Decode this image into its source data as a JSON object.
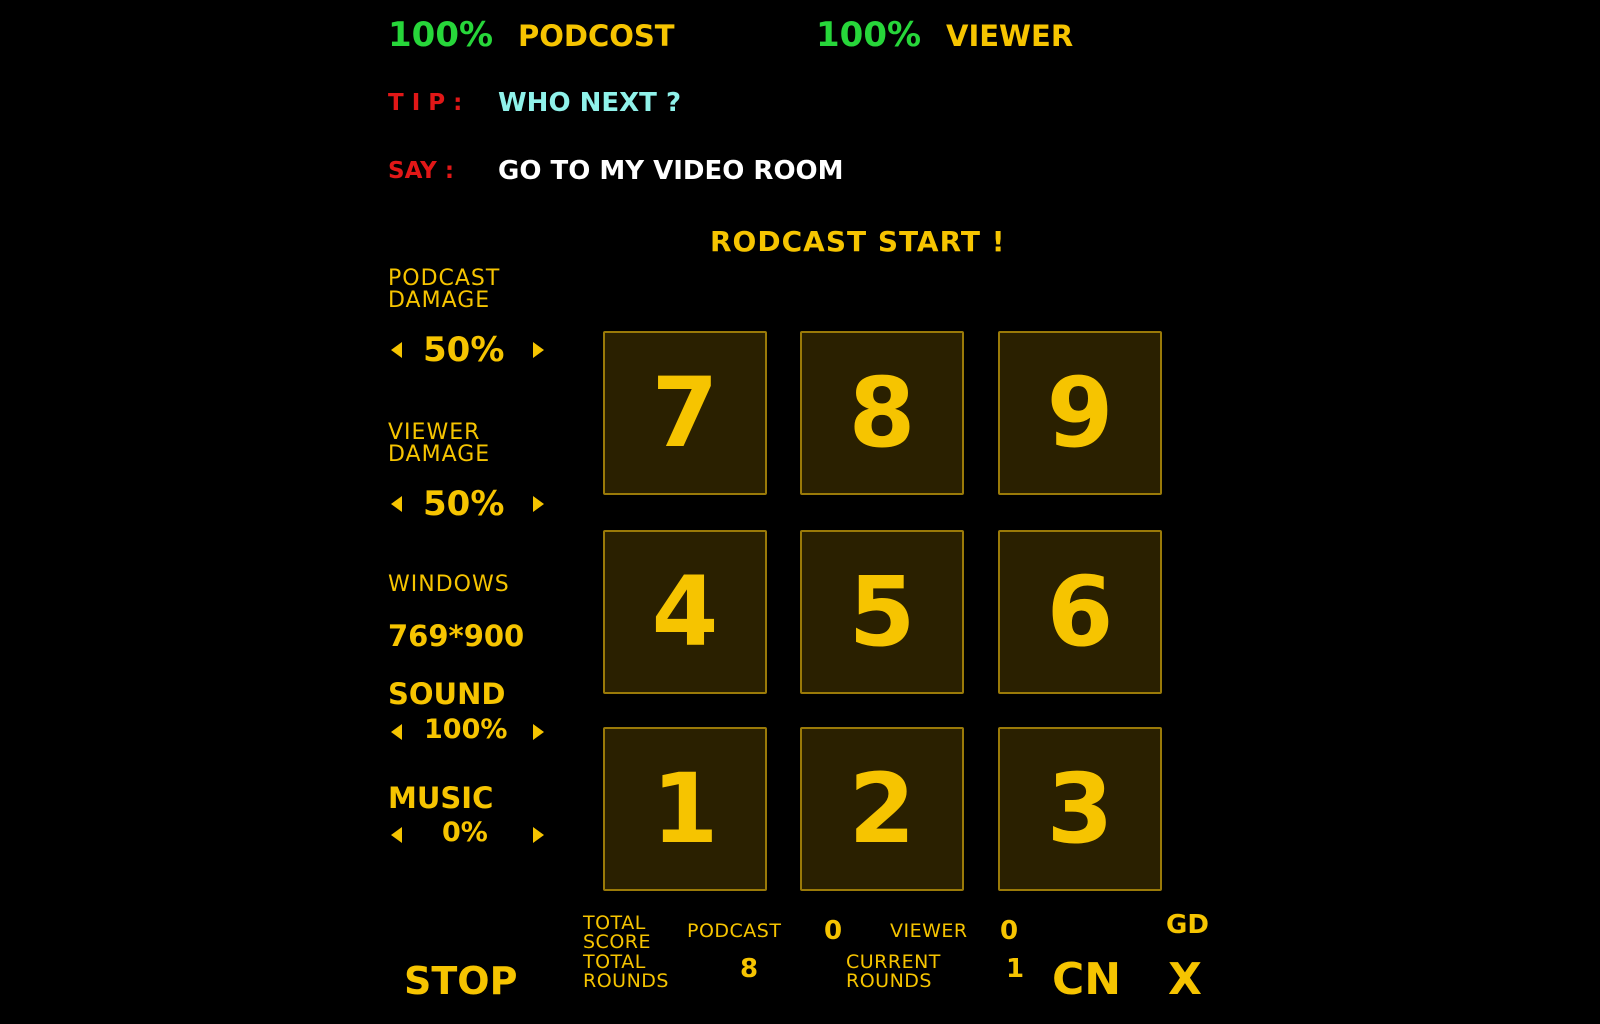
{
  "header": {
    "podcast_health": "100%",
    "podcast_label": "PODCOST",
    "viewer_health": "100%",
    "viewer_label": "VIEWER"
  },
  "tip": {
    "label": "T I P :",
    "text": "WHO NEXT ?"
  },
  "say": {
    "label": "SAY :",
    "text": "GO TO MY VIDEO ROOM"
  },
  "status_title": "RODCAST START !",
  "settings": {
    "podcast_damage": {
      "label_line1": "PODCAST",
      "label_line2": "DAMAGE",
      "value": "50%"
    },
    "viewer_damage": {
      "label_line1": "VIEWER",
      "label_line2": "DAMAGE",
      "value": "50%"
    },
    "windows": {
      "label": "WINDOWS",
      "value": "769*900"
    },
    "sound": {
      "label": "SOUND",
      "value": "100%"
    },
    "music": {
      "label": "MUSIC",
      "value": "0%"
    }
  },
  "keypad": [
    "7",
    "8",
    "9",
    "4",
    "5",
    "6",
    "1",
    "2",
    "3"
  ],
  "footer": {
    "stop_label": "STOP",
    "total_score_line1": "TOTAL",
    "total_score_line2": "SCORE",
    "podcast_label": "PODCAST",
    "podcast_score": "0",
    "viewer_label": "VIEWER",
    "viewer_score": "0",
    "total_rounds_line1": "TOTAL",
    "total_rounds_line2": "ROUNDS",
    "total_rounds_value": "8",
    "current_rounds_line1": "CURRENT",
    "current_rounds_line2": "ROUNDS",
    "current_rounds_value": "1",
    "lang_gd": "GD",
    "lang_cn": "CN",
    "close_label": "X"
  },
  "colors": {
    "accent": "#f6c400",
    "health": "#27d63a",
    "alert": "#e11717",
    "tip_text": "#8ff2ea",
    "button_bg": "#2a2000",
    "button_border": "#9a7a08"
  }
}
